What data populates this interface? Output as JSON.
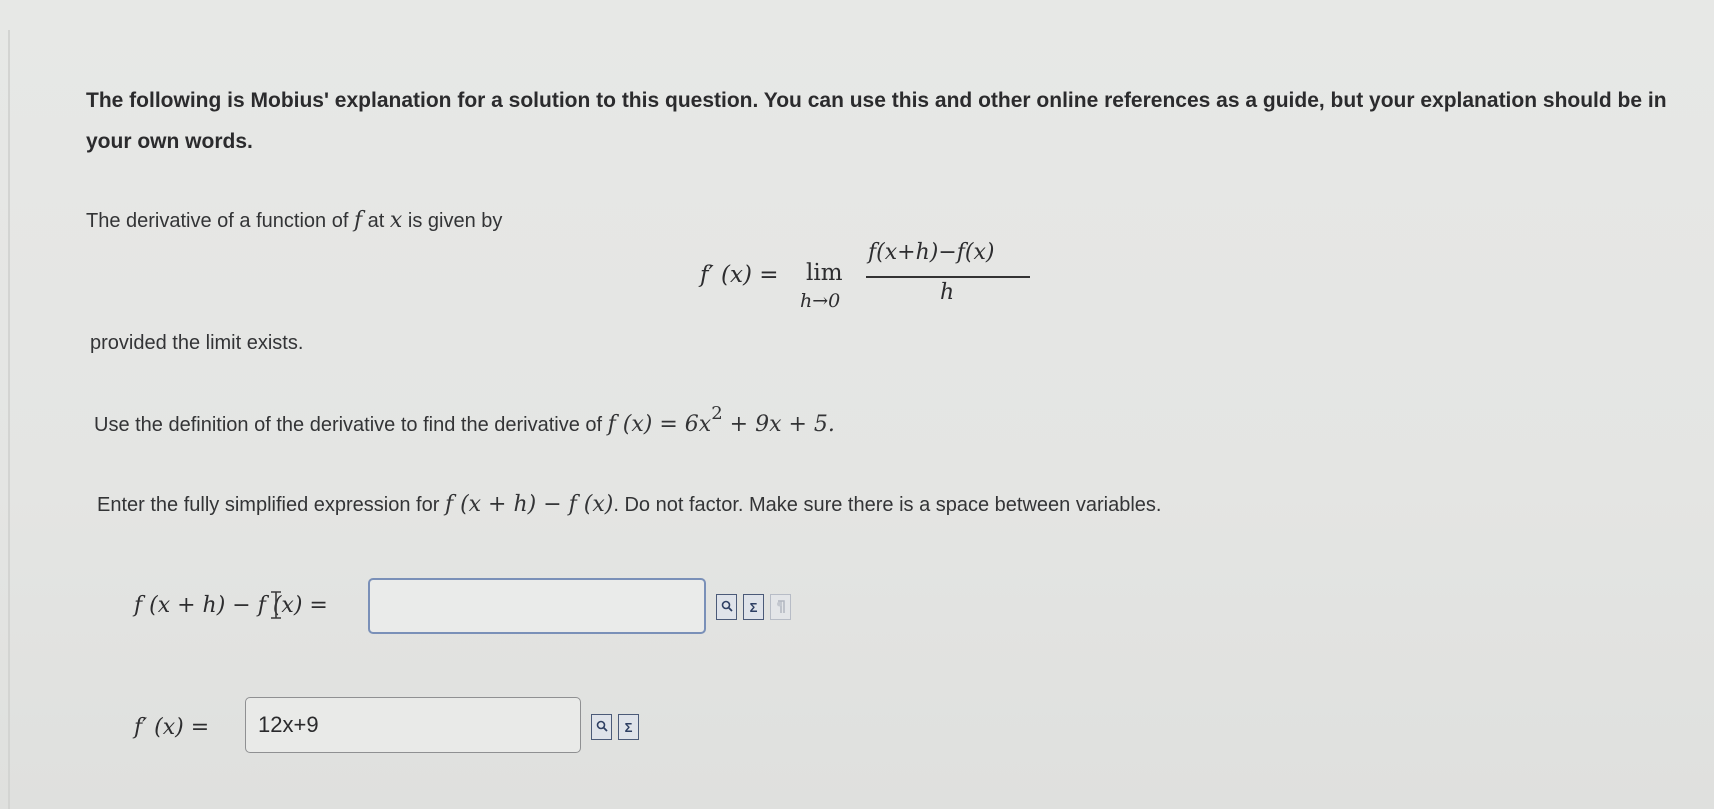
{
  "intro": "The following is Mobius' explanation for a solution to this question. You can use this and other online references as a guide, but your explanation should be in your own words.",
  "definition": {
    "text_before": "The derivative of a function of",
    "var_f": "f",
    "text_mid": "at",
    "var_x": "x",
    "text_after": "is given by"
  },
  "formula": {
    "lhs": "f′ (x) =",
    "lim": "lim",
    "lim_sub": "h→0",
    "numerator": "f(x+h)−f(x)",
    "denominator": "h"
  },
  "provided": "provided the limit exists.",
  "task": {
    "text": "Use the definition of the derivative to find the derivative of",
    "fx": "f (x) = 6x",
    "exponent": "2",
    "rest": "+ 9x + 5."
  },
  "instruction": {
    "text": "Enter the fully simplified expression for",
    "expr": "f (x + h) − f (x)",
    "text_after": ". Do not factor. Make sure there is a space between variables."
  },
  "answer1": {
    "label": "f (x + h) − f (x) =",
    "value": "",
    "tools": [
      "preview-icon",
      "sigma-icon",
      "paragraph-icon"
    ]
  },
  "answer2": {
    "label": "f′ (x) =",
    "value": "12x+9",
    "tools": [
      "preview-icon",
      "sigma-icon"
    ]
  },
  "colors": {
    "background": "#e5e6e4",
    "input_border": "#8f9092",
    "focus_border": "#7a90b8",
    "tool_icon": "#4b5a78"
  }
}
